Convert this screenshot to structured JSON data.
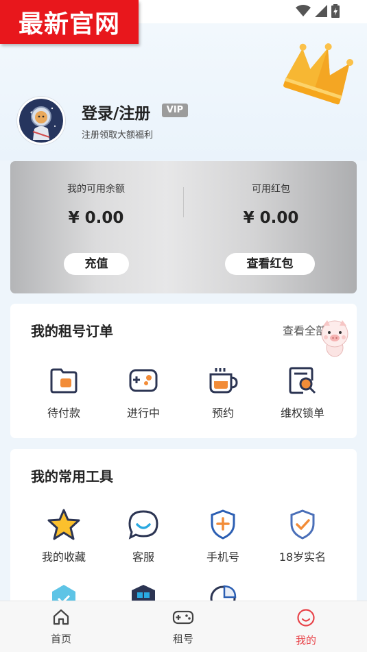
{
  "watermark": {
    "text": "最新官网"
  },
  "profile": {
    "login_title": "登录/注册",
    "vip_label": "VIP",
    "subtitle": "注册领取大额福利"
  },
  "wallet": {
    "balance_label": "我的可用余额",
    "balance_value": "¥ 0.00",
    "redpacket_label": "可用红包",
    "redpacket_value": "¥ 0.00",
    "recharge_button": "充值",
    "view_redpacket_button": "查看红包"
  },
  "orders": {
    "title": "我的租号订单",
    "view_all": "查看全部",
    "items": [
      {
        "label": "待付款",
        "icon": "wallet-icon"
      },
      {
        "label": "进行中",
        "icon": "gamepad-icon"
      },
      {
        "label": "预约",
        "icon": "coffee-cup-icon"
      },
      {
        "label": "维权锁单",
        "icon": "search-document-icon"
      }
    ]
  },
  "tools": {
    "title": "我的常用工具",
    "items": [
      {
        "label": "我的收藏",
        "icon": "star-icon"
      },
      {
        "label": "客服",
        "icon": "chat-bubble-icon"
      },
      {
        "label": "手机号",
        "icon": "shield-plus-icon"
      },
      {
        "label": "18岁实名",
        "icon": "shield-check-icon"
      }
    ]
  },
  "tabbar": {
    "items": [
      {
        "label": "首页",
        "icon": "home-icon"
      },
      {
        "label": "租号",
        "icon": "gamepad-icon"
      },
      {
        "label": "我的",
        "icon": "profile-icon"
      }
    ],
    "active_index": 2
  },
  "colors": {
    "accent": "#e8444a",
    "brand_red": "#e8171c",
    "icon_orange": "#f28c38",
    "icon_navy": "#2c3553"
  }
}
